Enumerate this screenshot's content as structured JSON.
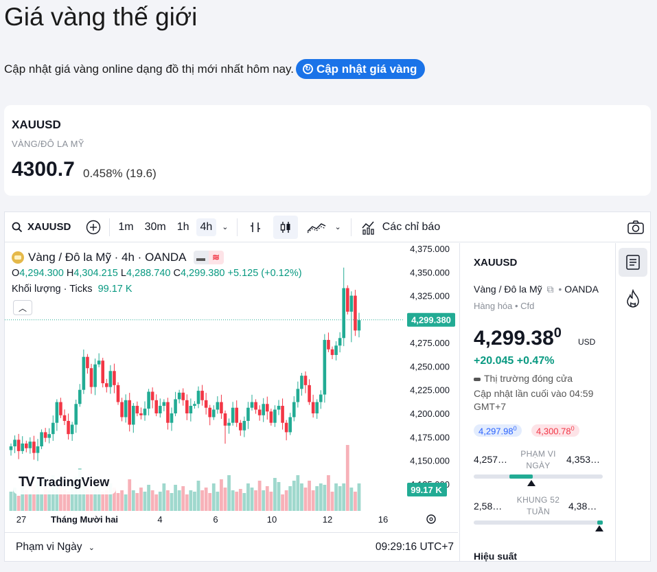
{
  "page": {
    "title": "Giá vàng thế giới",
    "subtitle": "Cập nhật giá vàng online dạng đồ thị mới nhất hôm nay.",
    "update_button": "Cập nhật giá vàng",
    "accent_color": "#1a73e8"
  },
  "quote": {
    "symbol": "XAUUSD",
    "description": "VÀNG/ĐÔ LA MỸ",
    "price": "4300.7",
    "change": "0.458% (19.6)"
  },
  "toolbar": {
    "symbol": "XAUUSD",
    "timeframes": [
      "1m",
      "30m",
      "1h",
      "4h"
    ],
    "active_timeframe": "4h",
    "indicators_label": "Các chỉ báo",
    "icons": [
      "search-icon",
      "add-symbol-icon",
      "chevron-down-icon",
      "bar-style-icon",
      "candle-style-icon",
      "area-style-icon",
      "indicators-icon",
      "camera-icon"
    ]
  },
  "chart": {
    "legend_title": "Vàng / Đô la Mỹ · 4h · OANDA",
    "ohlc": {
      "o_label": "O",
      "o": "4,294.300",
      "h_label": "H",
      "h": "4,304.215",
      "l_label": "L",
      "l": "4,288.740",
      "c_label": "C",
      "c": "4,299.380",
      "change": "+5.125 (+0.12%)"
    },
    "volume_label": "Khối lượng · Ticks",
    "volume_value": "99.17 K",
    "watermark": "TradingView",
    "range_label": "Phạm vi Ngày",
    "time_label": "09:29:16 UTC+7",
    "up_color": "#22ab94",
    "down_color": "#f23645"
  },
  "chart_data": {
    "type": "candlestick",
    "ylim": [
      4112.5,
      4375
    ],
    "y_ticks": [
      "4,375.000",
      "4,350.000",
      "4,325.000",
      "4,300.000",
      "4,275.000",
      "4,250.000",
      "4,225.000",
      "4,200.000",
      "4,175.000",
      "4,150.000",
      "4,125.000"
    ],
    "x_ticks": [
      "27",
      "Tháng Mười hai",
      "4",
      "6",
      "10",
      "12",
      "16"
    ],
    "last_price_label": "4,299.380",
    "volume_label_tag": "99.17 K",
    "candles_close": [
      4165,
      4172,
      4160,
      4168,
      4163,
      4170,
      4158,
      4165,
      4180,
      4174,
      4178,
      4190,
      4212,
      4198,
      4192,
      4178,
      4188,
      4210,
      4225,
      4260,
      4248,
      4228,
      4252,
      4256,
      4232,
      4228,
      4245,
      4230,
      4212,
      4196,
      4214,
      4188,
      4208,
      4200,
      4198,
      4205,
      4223,
      4214,
      4200,
      4208,
      4212,
      4190,
      4200,
      4215,
      4222,
      4214,
      4200,
      4208,
      4210,
      4224,
      4214,
      4206,
      4196,
      4204,
      4212,
      4200,
      4187,
      4190,
      4206,
      4190,
      4182,
      4192,
      4206,
      4212,
      4204,
      4198,
      4210,
      4202,
      4190,
      4204,
      4208,
      4190,
      4180,
      4196,
      4212,
      4226,
      4240,
      4230,
      4212,
      4200,
      4212,
      4220,
      4278,
      4268,
      4262,
      4272,
      4280,
      4333,
      4308,
      4325,
      4288,
      4299
    ],
    "series": [
      {
        "name": "Khối lượng · Ticks",
        "last_value": "99.17 K"
      }
    ]
  },
  "sidebar": {
    "symbol": "XAUUSD",
    "name": "Vàng / Đô la Mỹ",
    "exchange": "OANDA",
    "category": "Hàng hóa • Cfd",
    "price_main": "4,299.38",
    "price_sup": "0",
    "currency": "USD",
    "change": "+20.045  +0.47%",
    "status": "Thị trường đóng cửa",
    "last_update": "Cập nhật lần cuối vào 04:59 GMT+7",
    "bid": "4,297.98",
    "bid_sup": "0",
    "ask": "4,300.78",
    "ask_sup": "0",
    "day_low": "4,257…",
    "day_label": "PHẠM VI NGÀY",
    "day_high": "4,353…",
    "week52_low": "2,58…",
    "week52_label": "KHUNG 52 TUẦN",
    "week52_high": "4,38…",
    "performance": "Hiệu suất"
  }
}
